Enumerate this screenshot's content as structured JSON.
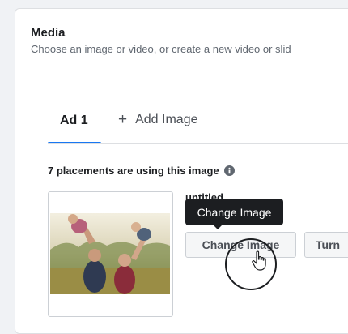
{
  "media": {
    "title": "Media",
    "subtitle": "Choose an image or video, or create a new video or slid"
  },
  "tabs": {
    "active_label": "Ad 1",
    "add_label": "Add Image",
    "add_icon": "plus-icon"
  },
  "placements": {
    "text": "7 placements are using this image",
    "icon": "info-icon"
  },
  "image": {
    "filename": "untitled",
    "change_button": "Change Image",
    "turn_button": "Turn",
    "tooltip": "Change Image"
  },
  "colors": {
    "accent": "#1877f2",
    "tooltip_bg": "#1c1e21"
  }
}
